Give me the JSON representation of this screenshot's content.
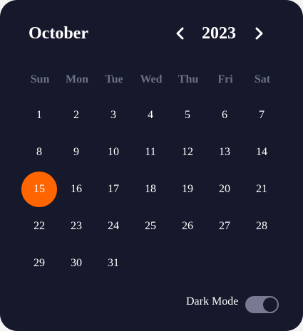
{
  "header": {
    "month": "October",
    "year": "2023"
  },
  "weekdays": [
    "Sun",
    "Mon",
    "Tue",
    "Wed",
    "Thu",
    "Fri",
    "Sat"
  ],
  "days": [
    "1",
    "2",
    "3",
    "4",
    "5",
    "6",
    "7",
    "8",
    "9",
    "10",
    "11",
    "12",
    "13",
    "14",
    "15",
    "16",
    "17",
    "18",
    "19",
    "20",
    "21",
    "22",
    "23",
    "24",
    "25",
    "26",
    "27",
    "28",
    "29",
    "30",
    "31"
  ],
  "selected_day": "15",
  "first_weekday_index": 0,
  "settings": {
    "dark_mode_label": "Dark Mode",
    "dark_mode_on": true
  },
  "colors": {
    "background": "#16182b",
    "accent": "#ff6500",
    "weekday_text": "#6c7088",
    "toggle_track": "#787a92"
  }
}
